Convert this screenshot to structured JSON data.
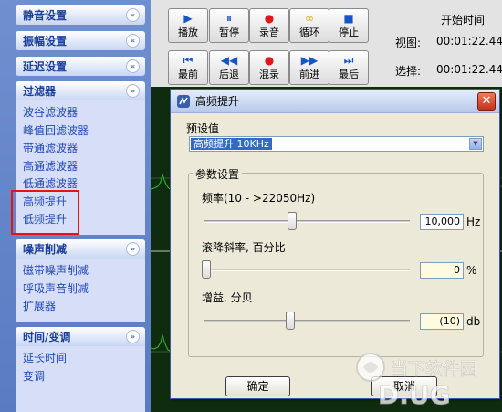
{
  "sidebar": {
    "groups": [
      {
        "title": "静音设置",
        "chevron": "«",
        "items": []
      },
      {
        "title": "振幅设置",
        "chevron": "«",
        "items": []
      },
      {
        "title": "延迟设置",
        "chevron": "«",
        "items": []
      },
      {
        "title": "过滤器",
        "chevron": "»",
        "items": [
          "波谷滤波器",
          "峰值回滤波器",
          "带通滤波器",
          "高通滤波器",
          "低通滤波器",
          "高频提升",
          "低频提升"
        ]
      },
      {
        "title": "噪声削减",
        "chevron": "»",
        "items": [
          "磁带噪声削减",
          "呼吸声音削减",
          "扩展器"
        ]
      },
      {
        "title": "时间/变调",
        "chevron": "»",
        "items": [
          "延长时间",
          "变调"
        ]
      }
    ],
    "highlight_color": "#e6140c"
  },
  "transport": {
    "row1": [
      {
        "glyph": "▶",
        "label": "播放",
        "color": "blue"
      },
      {
        "glyph": "⏸",
        "label": "暂停",
        "color": "blue"
      },
      {
        "glyph": "●",
        "label": "录音",
        "color": "red"
      },
      {
        "glyph": "∞",
        "label": "循环",
        "color": "gold"
      },
      {
        "glyph": "■",
        "label": "停止",
        "color": "blue"
      }
    ],
    "row2": [
      {
        "glyph": "⏮",
        "label": "最前",
        "color": "blue"
      },
      {
        "glyph": "◀◀",
        "label": "后退",
        "color": "blue"
      },
      {
        "glyph": "●",
        "label": "混录",
        "color": "red"
      },
      {
        "glyph": "▶▶",
        "label": "前进",
        "color": "blue"
      },
      {
        "glyph": "⏭",
        "label": "最后",
        "color": "blue"
      }
    ]
  },
  "time_panel": {
    "title": "开始时间",
    "view_label": "视图:",
    "view_value": "00:01:22.44",
    "select_label": "选择:",
    "select_value": "00:01:22.44"
  },
  "dialog": {
    "title": "高频提升",
    "preset_label": "预设值",
    "preset_value": "高频提升 10KHz",
    "group_title": "参数设置",
    "params": [
      {
        "label": "频率(10 - >22050Hz)",
        "value": "10,000",
        "unit": "Hz",
        "slider_fraction": 0.43
      },
      {
        "label": "滚降斜率, 百分比",
        "value": "0",
        "unit": "%",
        "slider_fraction": 0.0
      },
      {
        "label": "增益, 分贝",
        "value": "(10)",
        "unit": "db",
        "slider_fraction": 0.42
      }
    ],
    "ok_label": "确定",
    "cancel_label": "取消"
  },
  "watermark": {
    "text": "当下软件园",
    "logo_text": "D.UG"
  },
  "colors": {
    "accent_blue": "#316ac5",
    "sidebar_link": "#2149b7",
    "waveform": "#2fbf2f"
  }
}
